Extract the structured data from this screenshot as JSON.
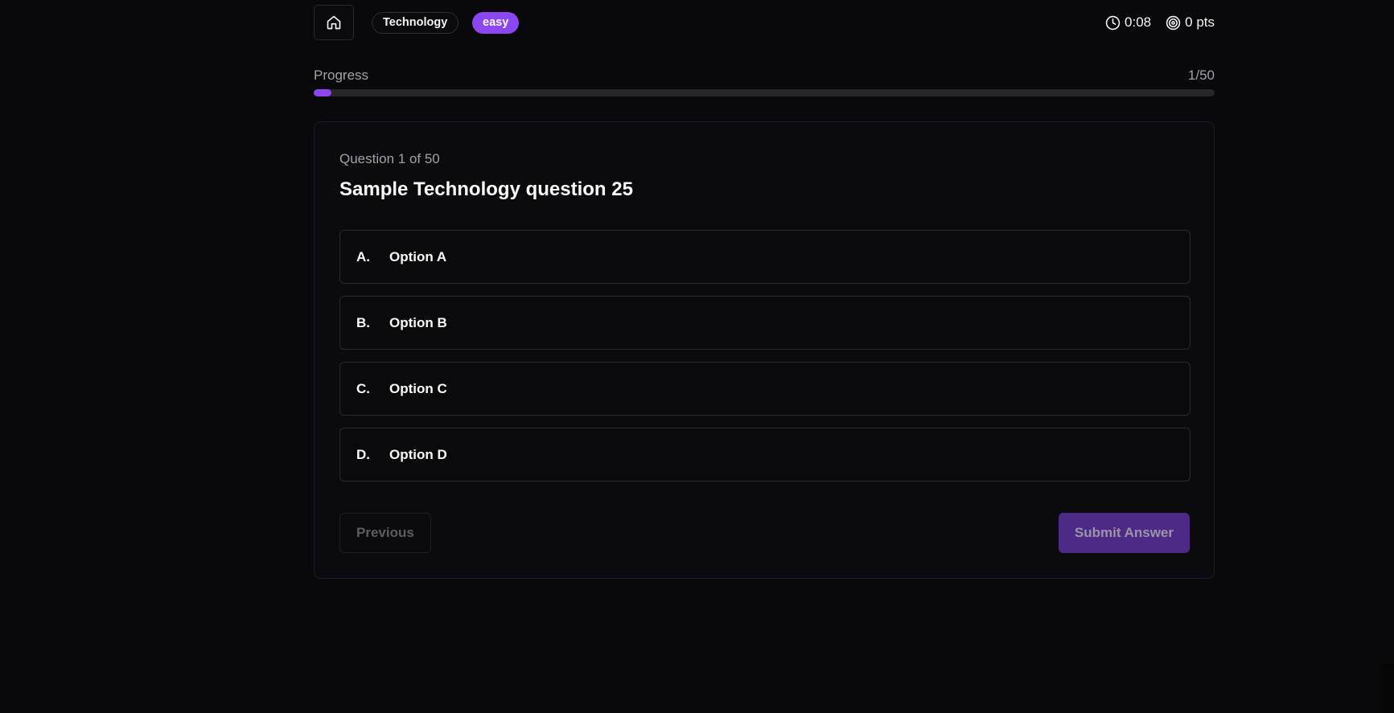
{
  "header": {
    "home_icon": "home-icon",
    "category": "Technology",
    "difficulty": "easy",
    "timer": "0:08",
    "points": "0 pts",
    "timer_icon": "clock-icon",
    "points_icon": "target-icon"
  },
  "progress": {
    "label": "Progress",
    "count": "1/50",
    "fraction": 0.02
  },
  "question": {
    "counter": "Question 1 of 50",
    "title": "Sample Technology question 25",
    "options": [
      {
        "letter": "A.",
        "text": "Option A"
      },
      {
        "letter": "B.",
        "text": "Option B"
      },
      {
        "letter": "C.",
        "text": "Option C"
      },
      {
        "letter": "D.",
        "text": "Option D"
      }
    ]
  },
  "actions": {
    "previous_label": "Previous",
    "submit_label": "Submit Answer"
  },
  "colors": {
    "accent": "#8b46f2",
    "background": "#09090b"
  }
}
